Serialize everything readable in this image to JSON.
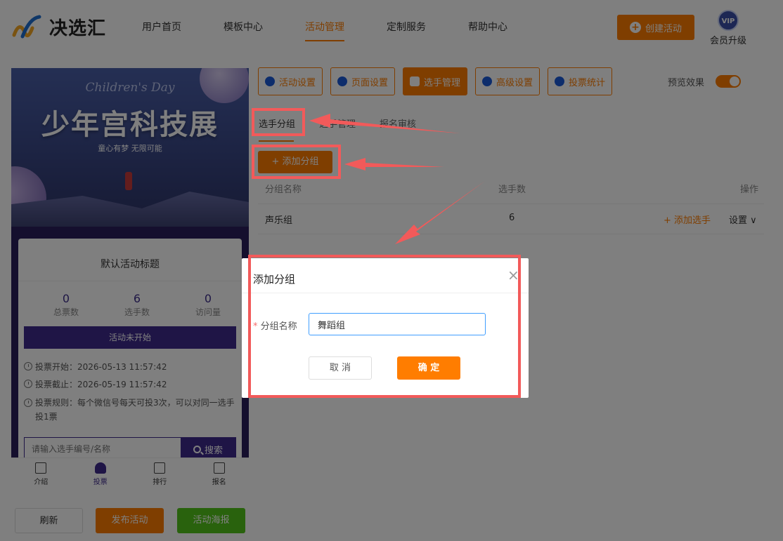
{
  "brand": {
    "name": "决选汇"
  },
  "nav": {
    "items": [
      "用户首页",
      "模板中心",
      "活动管理",
      "定制服务",
      "帮助中心"
    ],
    "active_index": 2
  },
  "header": {
    "create_label": "创建活动",
    "vip_badge": "VIP",
    "vip_label": "会员升级"
  },
  "preview": {
    "poster_en": "Children's Day",
    "poster_title": "少年宫科技展",
    "poster_sub": "童心有梦 无限可能",
    "activity_title": "默认活动标题",
    "stats": [
      {
        "value": "0",
        "label": "总票数"
      },
      {
        "value": "6",
        "label": "选手数"
      },
      {
        "value": "0",
        "label": "访问量"
      }
    ],
    "status_label": "活动未开始",
    "vote_start": "投票开始：2026-05-13 11:57:42",
    "vote_end": "投票截止：2026-05-19 11:57:42",
    "vote_rule": "投票规则：每个微信号每天可投3次，可以对同一选手投1票",
    "search_placeholder": "请输入选手编号/名称",
    "search_label": "搜索",
    "tabs": [
      {
        "label": "介绍"
      },
      {
        "label": "投票"
      },
      {
        "label": "排行"
      },
      {
        "label": "报名"
      }
    ],
    "active_tab": 1
  },
  "actions": {
    "refresh": "刷新",
    "publish": "发布活动",
    "poster": "活动海报"
  },
  "toolbar": {
    "buttons": [
      "活动设置",
      "页面设置",
      "选手管理",
      "高级设置",
      "投票统计"
    ],
    "active_index": 2,
    "preview_label": "预览效果",
    "preview_on": true
  },
  "subtabs": {
    "items": [
      "选手分组",
      "选手管理",
      "报名审核"
    ],
    "active_index": 0
  },
  "group": {
    "add_label": "+ 添加分组",
    "columns": [
      "分组名称",
      "选手数",
      "操作"
    ],
    "rows": [
      {
        "name": "声乐组",
        "count": "6",
        "add_player": "+ 添加选手",
        "settings": "设置 ∨"
      }
    ]
  },
  "dialog": {
    "title": "添加分组",
    "field_label": "分组名称",
    "field_value": "舞蹈组",
    "cancel": "取 消",
    "confirm": "确 定"
  },
  "colors": {
    "accent": "#ff7d00",
    "theme_purple": "#3e2a8c",
    "highlight_red": "#f25a5a",
    "success": "#52c41a"
  }
}
